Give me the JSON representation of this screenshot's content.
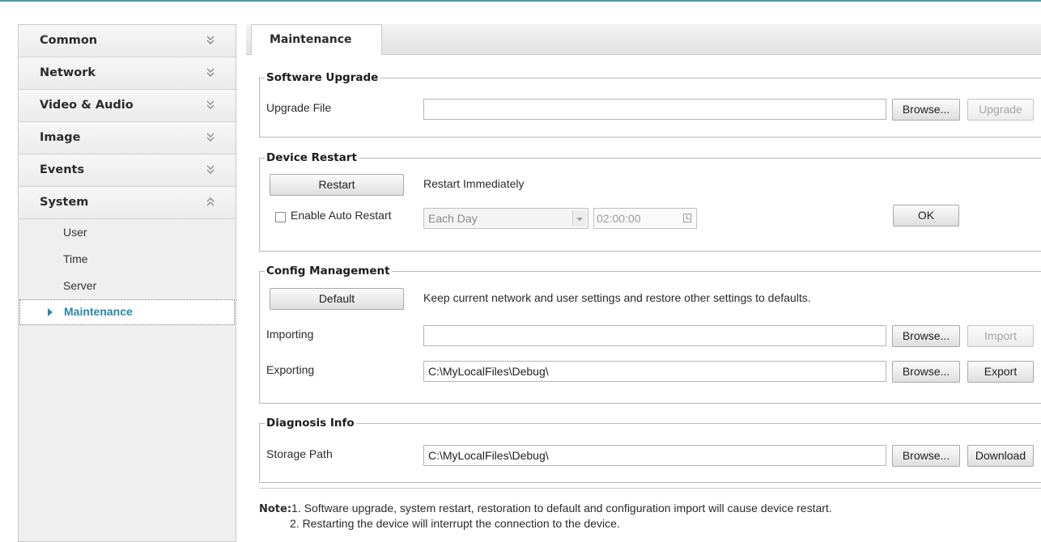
{
  "sidebar": {
    "categories": [
      {
        "label": "Common"
      },
      {
        "label": "Network"
      },
      {
        "label": "Video & Audio"
      },
      {
        "label": "Image"
      },
      {
        "label": "Events"
      },
      {
        "label": "System"
      }
    ],
    "system_items": [
      {
        "label": "User"
      },
      {
        "label": "Time"
      },
      {
        "label": "Server"
      },
      {
        "label": "Maintenance"
      }
    ]
  },
  "tabs": [
    {
      "label": "Maintenance"
    }
  ],
  "software_upgrade": {
    "legend": "Software Upgrade",
    "file_label": "Upgrade File",
    "file_value": "",
    "browse_label": "Browse...",
    "upgrade_label": "Upgrade"
  },
  "device_restart": {
    "legend": "Device Restart",
    "restart_label": "Restart",
    "restart_desc": "Restart Immediately",
    "auto_restart_label": "Enable Auto Restart",
    "schedule_value": "Each Day",
    "time_value": "02:00:00",
    "ok_label": "OK"
  },
  "config_management": {
    "legend": "Config Management",
    "default_label": "Default",
    "default_desc": "Keep current network and user settings and restore other settings to defaults.",
    "importing_label": "Importing",
    "importing_value": "",
    "import_browse_label": "Browse...",
    "import_label": "Import",
    "exporting_label": "Exporting",
    "exporting_value": "C:\\MyLocalFiles\\Debug\\",
    "export_browse_label": "Browse...",
    "export_label": "Export"
  },
  "diagnosis_info": {
    "legend": "Diagnosis Info",
    "storage_label": "Storage Path",
    "storage_value": "C:\\MyLocalFiles\\Debug\\",
    "browse_label": "Browse...",
    "download_label": "Download"
  },
  "note": {
    "prefix": "Note:",
    "line1": "1. Software upgrade, system restart, restoration to default and configuration import will cause device restart.",
    "line2": "2. Restarting the device will interrupt the connection to the device."
  },
  "colors": {
    "accent": "#2b86a6",
    "top_border": "#4a9aa8"
  },
  "icons": {
    "collapsed": "double-chevron-down-icon",
    "expanded": "double-chevron-up-icon",
    "selected": "triangle-right-icon"
  }
}
